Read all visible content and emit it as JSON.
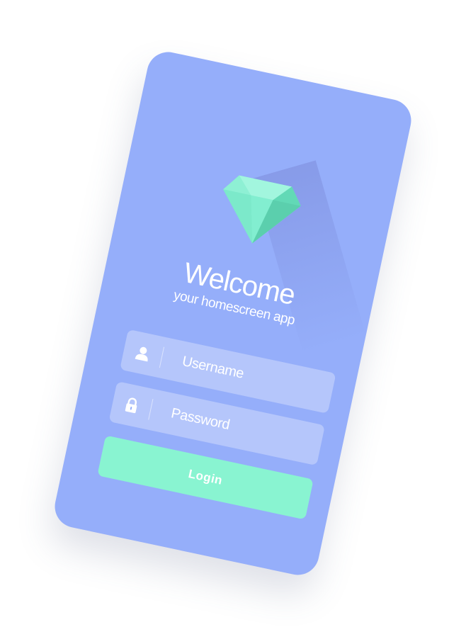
{
  "app": {
    "title": "Welcome",
    "subtitle": "your homescreen app"
  },
  "form": {
    "username_placeholder": "Username",
    "password_placeholder": "Password",
    "login_label": "Login"
  },
  "icons": {
    "logo": "diamond-icon",
    "username": "user-icon",
    "password": "lock-icon"
  },
  "colors": {
    "card_background": "#95aefa",
    "accent": "#89f4d1",
    "field_background": "rgba(255,255,255,0.3)",
    "text": "#ffffff"
  }
}
